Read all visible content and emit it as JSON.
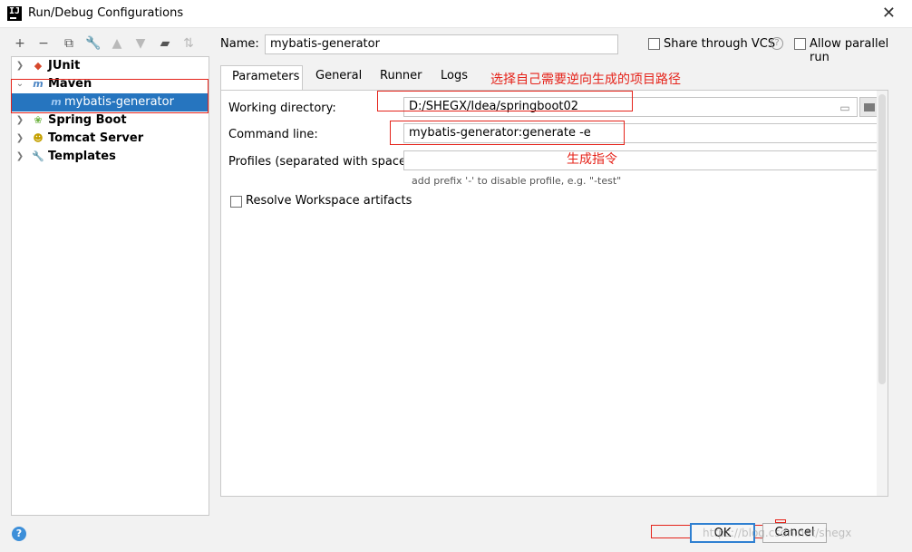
{
  "window": {
    "title": "Run/Debug Configurations",
    "app_icon": "IJ"
  },
  "toolbar": {
    "icons": [
      "plus-icon",
      "minus-icon",
      "copy-icon",
      "wrench-icon",
      "arrow-up-icon",
      "arrow-down-icon",
      "new-folder-icon",
      "sort-icon"
    ]
  },
  "tree": {
    "items": [
      {
        "label": "JUnit"
      },
      {
        "label": "Maven"
      },
      {
        "label": "mybatis-generator"
      },
      {
        "label": "Spring Boot"
      },
      {
        "label": "Tomcat Server"
      },
      {
        "label": "Templates"
      }
    ]
  },
  "config": {
    "name_label": "Name:",
    "name_value": "mybatis-generator",
    "share_vcs_label": "Share through VCS",
    "allow_parallel_label": "Allow parallel run"
  },
  "tabs": [
    {
      "label": "Parameters",
      "active": true
    },
    {
      "label": "General"
    },
    {
      "label": "Runner"
    },
    {
      "label": "Logs"
    }
  ],
  "parameters": {
    "working_dir_label": "Working directory:",
    "working_dir_value": "D:/SHEGX/Idea/springboot02",
    "command_line_label": "Command line:",
    "command_line_value": "mybatis-generator:generate -e",
    "profiles_label": "Profiles (separated with space):",
    "profiles_value": "",
    "profiles_hint": "add prefix '-' to disable profile, e.g. \"-test\"",
    "resolve_artifacts_label": "Resolve Workspace artifacts"
  },
  "annotations": {
    "working_dir_note": "选择自己需要逆向生成的项目路径",
    "command_note": "生成指令",
    "color": "#e5231a"
  },
  "buttons": {
    "ok": "OK",
    "cancel": "Cancel",
    "help": "?"
  },
  "watermark": "https://blog.csdn.net/shegx"
}
